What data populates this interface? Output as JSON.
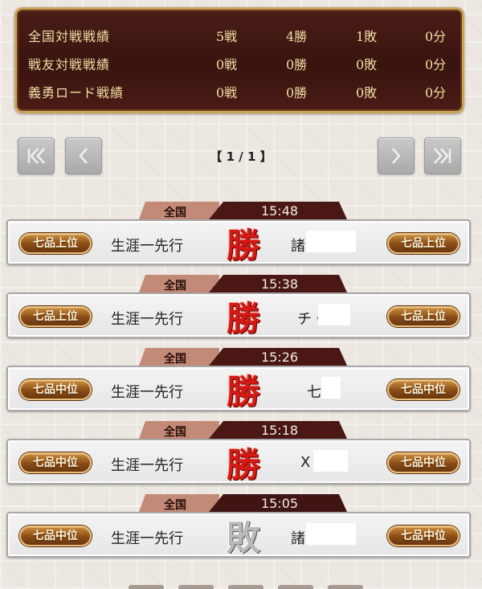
{
  "summary": [
    {
      "label": "全国対戦戦績",
      "battles": "5戦",
      "wins": "4勝",
      "losses": "1敗",
      "draws": "0分"
    },
    {
      "label": "戦友対戦戦績",
      "battles": "0戦",
      "wins": "0勝",
      "losses": "0敗",
      "draws": "0分"
    },
    {
      "label": "義勇ロード戦績",
      "battles": "0戦",
      "wins": "0勝",
      "losses": "0敗",
      "draws": "0分"
    }
  ],
  "pagination": {
    "indicator": "【 1 / 1 】",
    "first_icon": "first-page-icon",
    "prev_icon": "chevron-left-icon",
    "next_icon": "chevron-right-icon",
    "last_icon": "last-page-icon"
  },
  "matches": [
    {
      "mode": "全国",
      "time": "15:48",
      "player_rank": "七品上位",
      "player_name": "生涯一先行",
      "result": "勝",
      "opponent_name": "諸",
      "opponent_rank": "七品上位"
    },
    {
      "mode": "全国",
      "time": "15:38",
      "player_rank": "七品上位",
      "player_name": "生涯一先行",
      "result": "勝",
      "opponent_name": "チ・",
      "opponent_rank": "七品上位"
    },
    {
      "mode": "全国",
      "time": "15:26",
      "player_rank": "七品中位",
      "player_name": "生涯一先行",
      "result": "勝",
      "opponent_name": "七",
      "opponent_rank": "七品中位"
    },
    {
      "mode": "全国",
      "time": "15:18",
      "player_rank": "七品中位",
      "player_name": "生涯一先行",
      "result": "勝",
      "opponent_name": "X",
      "opponent_rank": "七品中位"
    },
    {
      "mode": "全国",
      "time": "15:05",
      "player_rank": "七品中位",
      "player_name": "生涯一先行",
      "result": "敗",
      "opponent_name": "諸",
      "opponent_rank": "七品中位"
    }
  ],
  "colors": {
    "panel_bg": "#3a130f",
    "panel_border": "#c9a45a",
    "win_mark": "#d41a14",
    "lose_mark": "#b9b9b9",
    "time_tab": "#4a1715",
    "mode_tab": "#c48a78"
  }
}
